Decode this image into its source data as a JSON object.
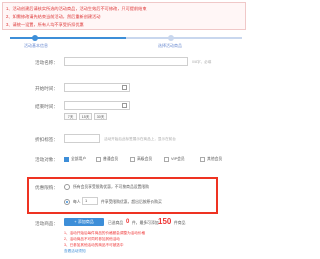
{
  "notice": {
    "lines": [
      "1、活动创建后请核实所选的活动商品，活动生效后不可修改，只可提前结束",
      "2、如需修改请先结束当前活动，然后重新创建活动",
      "3、请统一设置，所有人均不享受折扣优惠"
    ]
  },
  "steps": {
    "step1": "活动基本信息",
    "step2": "选择活动商品"
  },
  "form": {
    "name_label": "活动名称：",
    "name_hint": "0/8字，必填",
    "start_label": "开始时间：",
    "end_label": "结束时间：",
    "day_buttons": [
      "7天",
      "15天",
      "30天"
    ],
    "discount_label": "折扣标签：",
    "discount_hint": "活动开始后此标签展示在商品上，显示在前台",
    "user_label": "活动对象：",
    "user_options": [
      "全部用户",
      "普通会员",
      "高级会员",
      "VIP会员",
      "其他会员"
    ],
    "limit_label": "优惠限购：",
    "limit_option_1": "所有会员享受限购优惠，不可按商品设置限购",
    "limit_option_2_prefix": "每人",
    "limit_option_2_value": "1",
    "limit_option_2_suffix": "件享受限购优惠，超出后按原价购买",
    "goods_label": "活动商品：",
    "add_goods_button": "+ 添加商品",
    "goods_count_prefix": "已选商品",
    "goods_count_mid": "件，最多可添加",
    "goods_count_max": "150",
    "goods_count_suffix": "件商品"
  },
  "bottom_notes": [
    "1、活动开始后每件商品的价格都会调整为活动价格",
    "2、活动商品不可同时参加其他活动",
    "3、已参加其他活动的商品不可被选中"
  ],
  "bottom_link": "查看活动须知",
  "colors": {
    "accent": "#3d8ed8",
    "warning": "#e33"
  }
}
